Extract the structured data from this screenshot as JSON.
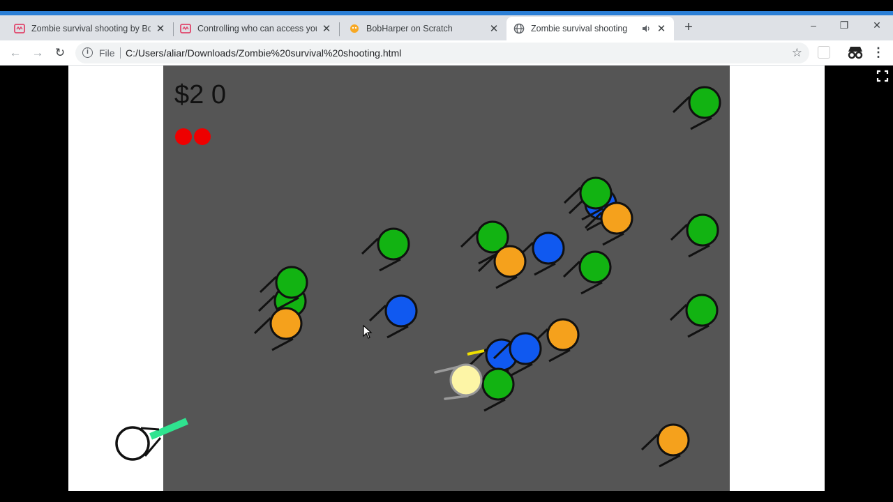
{
  "tabs": [
    {
      "title": "Zombie survival shooting by Bob",
      "icon": "scratch-studio-icon",
      "active": false
    },
    {
      "title": "Controlling who can access your",
      "icon": "scratch-studio-icon",
      "active": false
    },
    {
      "title": "BobHarper on Scratch",
      "icon": "scratch-cat-icon",
      "active": false
    },
    {
      "title": "Zombie survival shooting",
      "icon": "globe-icon",
      "active": true,
      "audio": true
    }
  ],
  "new_tab_label": "+",
  "window_controls": {
    "minimize": "–",
    "restore": "❐",
    "close": "✕"
  },
  "toolbar": {
    "back": "←",
    "forward": "→",
    "reload": "↻",
    "scheme_label": "File",
    "url": "C:/Users/aliar/Downloads/Zombie%20survival%20shooting.html",
    "bookmark_icon": "☆",
    "menu": "⋮"
  },
  "game": {
    "hud": {
      "money": "$2 0",
      "lives": 2
    },
    "colors": {
      "field": "#555555",
      "green": "#12b312",
      "orange": "#f5a11c",
      "blue": "#1059f0",
      "player": "#fdf5a6",
      "life": "#ee0000",
      "turret_barrel": "#2fe38f",
      "bullet": "#f0e000"
    }
  }
}
